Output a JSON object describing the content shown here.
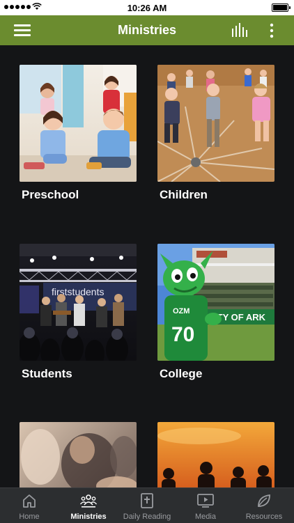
{
  "status": {
    "time": "10:26 AM"
  },
  "nav": {
    "title": "Ministries"
  },
  "ministries": [
    {
      "label": "Preschool"
    },
    {
      "label": "Children"
    },
    {
      "label": "Students"
    },
    {
      "label": "College"
    },
    {
      "label": ""
    },
    {
      "label": ""
    }
  ],
  "photo_text": {
    "students_banner": "firststudents",
    "college_banner": "RSITY OF ARK"
  },
  "tabs": [
    {
      "label": "Home",
      "icon": "home-icon",
      "active": false
    },
    {
      "label": "Ministries",
      "icon": "people-icon",
      "active": true
    },
    {
      "label": "Daily Reading",
      "icon": "bible-icon",
      "active": false
    },
    {
      "label": "Media",
      "icon": "play-icon",
      "active": false
    },
    {
      "label": "Resources",
      "icon": "leaf-icon",
      "active": false
    }
  ],
  "colors": {
    "nav_bar": "#6b8c2f",
    "background": "#141517",
    "tab_bar": "#2c2e30"
  }
}
